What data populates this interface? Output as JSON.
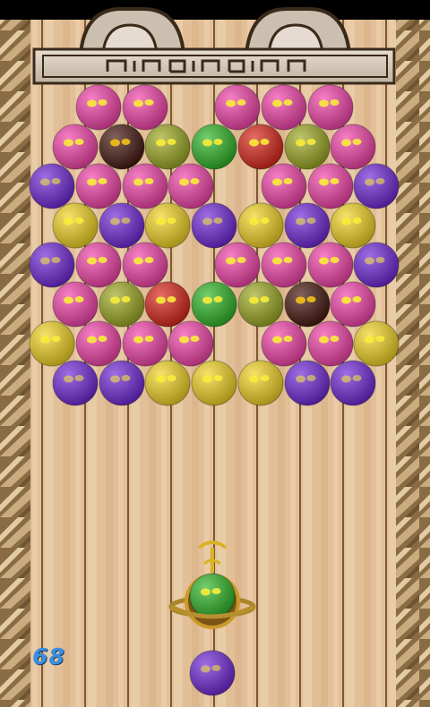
{
  "colors": {
    "pink": "#f23ba6",
    "yellow": "#f2d31a",
    "purple": "#6a1fd6",
    "olive": "#9aa61a",
    "green": "#27b31f",
    "red": "#d81d10",
    "dark": "#3d0d05",
    "wood_light": "#e8c7a0",
    "wood_dark": "#b88c60",
    "rope": "#a98a5c"
  },
  "game": {
    "title_icon": "decorative-banner",
    "score": "68",
    "rows": [
      [
        "pink",
        "pink",
        null,
        "pink",
        "pink",
        "pink"
      ],
      [
        "pink",
        "dark",
        "olive",
        "green",
        "red",
        "olive",
        "pink"
      ],
      [
        "purple",
        "pink",
        "pink",
        "pink",
        null,
        "pink",
        "pink",
        "purple"
      ],
      [
        "yellow",
        "purple",
        "yellow",
        "purple",
        "yellow",
        "purple",
        "yellow"
      ],
      [
        "purple",
        "pink",
        "pink",
        null,
        "pink",
        "pink",
        "pink",
        "purple"
      ],
      [
        "pink",
        "olive",
        "red",
        "green",
        "olive",
        "dark",
        "pink"
      ],
      [
        "yellow",
        "pink",
        "pink",
        "pink",
        null,
        "pink",
        "pink",
        "yellow"
      ],
      [
        "purple",
        "purple",
        "yellow",
        "yellow",
        "yellow",
        "purple",
        "purple"
      ]
    ],
    "launcher_ball": "green",
    "next_ball": "purple"
  }
}
